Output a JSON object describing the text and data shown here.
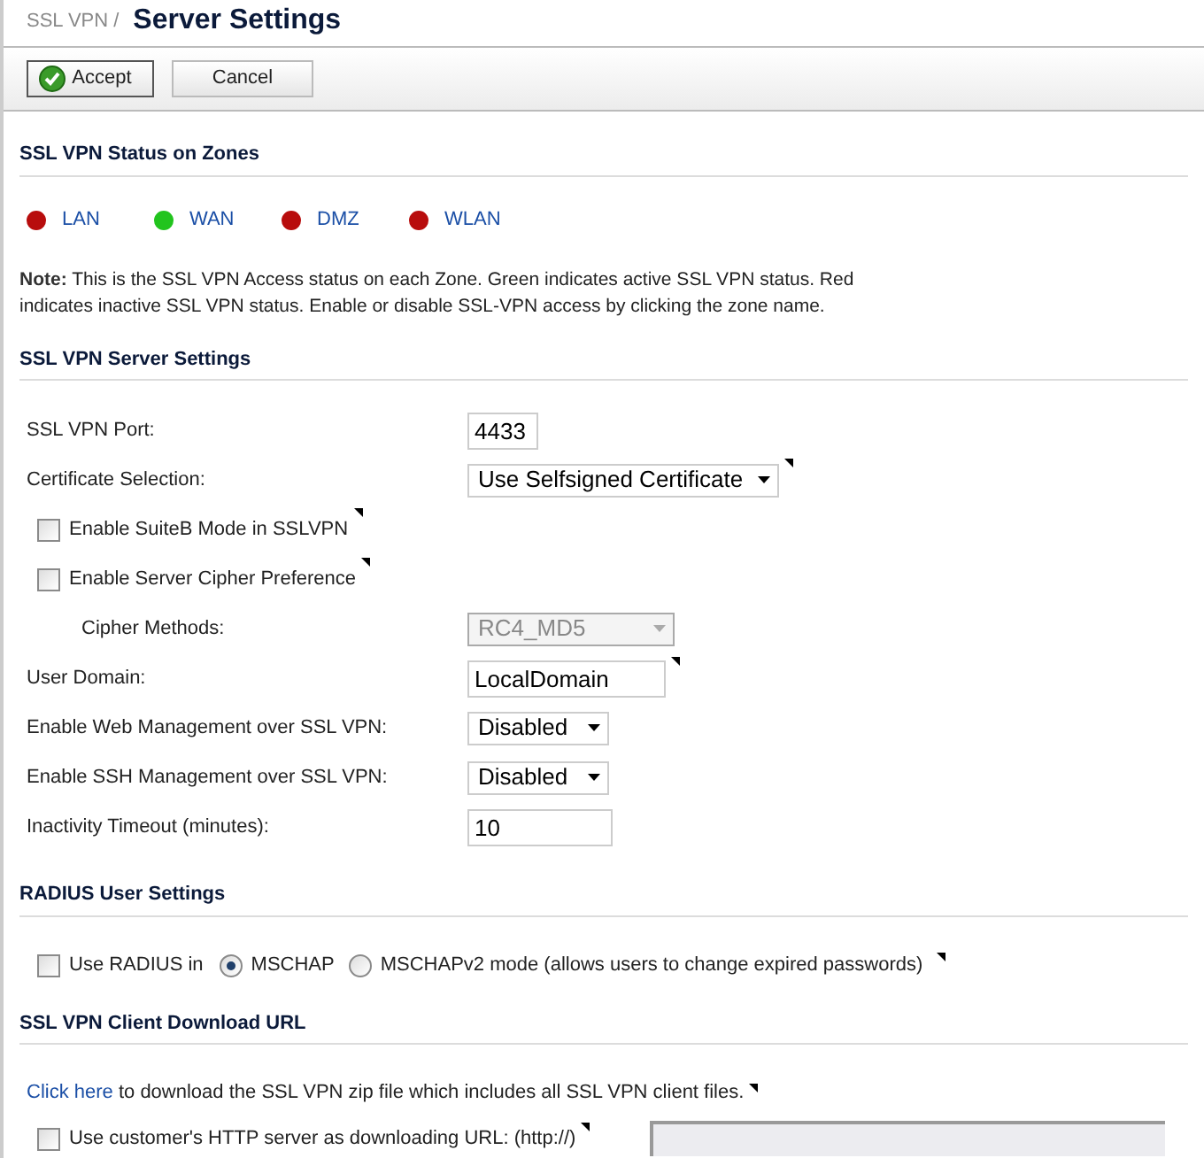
{
  "breadcrumb": "SSL VPN /",
  "title": "Server Settings",
  "toolbar": [
    {
      "label": "Accept",
      "kind": "accept"
    },
    {
      "label": "Cancel",
      "kind": "plain"
    }
  ],
  "zones_section": {
    "heading": "SSL VPN Status on Zones",
    "zones": [
      {
        "label": "LAN",
        "active": false
      },
      {
        "label": "WAN",
        "active": true
      },
      {
        "label": "DMZ",
        "active": false
      },
      {
        "label": "WLAN",
        "active": false
      }
    ],
    "note_label": "Note:",
    "note": "This is the SSL VPN Access status on each Zone. Green indicates active SSL VPN status. Red indicates inactive SSL VPN status. Enable or disable SSL-VPN access by clicking the zone name."
  },
  "server_section": {
    "heading": "SSL VPN Server Settings",
    "rows": [
      {
        "kind": "input",
        "label": "SSL VPN Port:",
        "value": "4433",
        "tip": false
      },
      {
        "kind": "select",
        "label": "Certificate Selection:",
        "value": "Use Selfsigned Certificate",
        "disabled": false,
        "tip": true
      },
      {
        "kind": "checkbox",
        "label": "Enable SuiteB Mode in SSLVPN",
        "checked": false,
        "tip": true
      },
      {
        "kind": "checkbox",
        "label": "Enable Server Cipher Preference",
        "checked": false,
        "tip": true,
        "children": [
          {
            "kind": "select",
            "label": "Cipher Methods:",
            "value": "RC4_MD5",
            "disabled": true,
            "tip": false
          }
        ]
      },
      {
        "kind": "input",
        "label": "User Domain:",
        "value": "LocalDomain",
        "tip": true
      },
      {
        "kind": "select",
        "label": "Enable Web Management over SSL VPN:",
        "value": "Disabled",
        "disabled": false,
        "tip": false
      },
      {
        "kind": "select",
        "label": "Enable SSH Management over SSL VPN:",
        "value": "Disabled",
        "disabled": false,
        "tip": false
      },
      {
        "kind": "input",
        "label": "Inactivity Timeout (minutes):",
        "value": "10",
        "tip": false
      }
    ]
  },
  "radius_section": {
    "heading": "RADIUS User Settings",
    "checkbox": {
      "label": "Use RADIUS in",
      "checked": false
    },
    "options": [
      {
        "label": "MSCHAP",
        "selected": true
      },
      {
        "label": "MSCHAPv2 mode (allows users to change expired passwords)",
        "selected": false
      }
    ],
    "tip": true
  },
  "download_section": {
    "heading": "SSL VPN Client Download URL",
    "link": "Click here",
    "text": " to download the SSL VPN zip file which includes all SSL VPN client files.",
    "tip": true,
    "custom_url": {
      "label": "Use customer's HTTP server as downloading URL: (http://)",
      "checked": false,
      "tip": true,
      "field_disabled": true
    }
  }
}
